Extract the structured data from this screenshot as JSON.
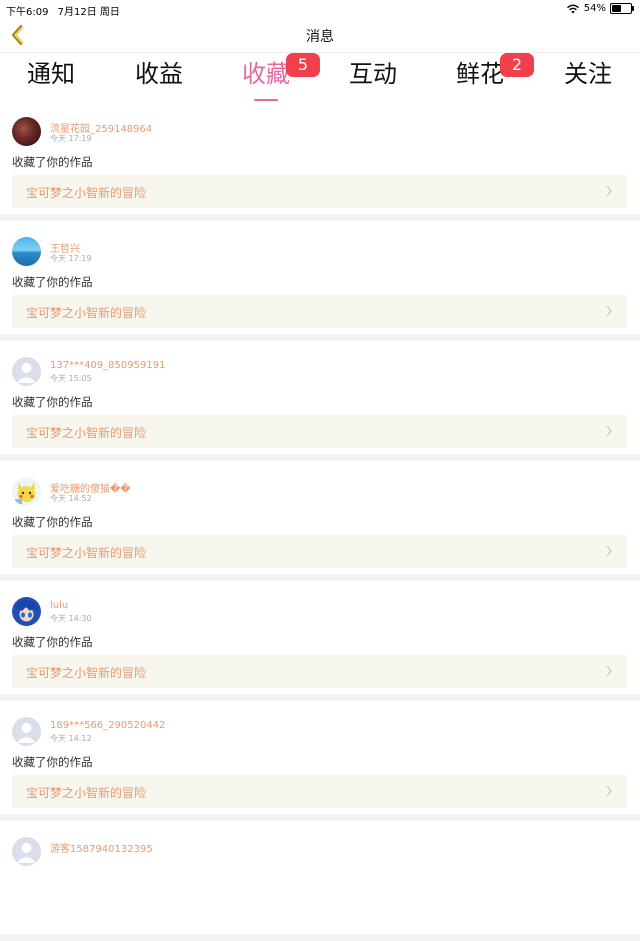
{
  "status_bar": {
    "time": "下午6:09",
    "date": "7月12日 周日",
    "battery": "54%",
    "battery_level": 0.54
  },
  "nav": {
    "title": "消息",
    "back_icon": "chevron-left-icon",
    "accent_color": "#e56aa0"
  },
  "tabs": [
    {
      "label": "通知",
      "badge": ""
    },
    {
      "label": "收益",
      "badge": ""
    },
    {
      "label": "收藏",
      "badge": "5",
      "active": true
    },
    {
      "label": "互动",
      "badge": ""
    },
    {
      "label": "鲜花",
      "badge": "2"
    },
    {
      "label": "关注",
      "badge": ""
    }
  ],
  "items": [
    {
      "user": "流星花园_259148964",
      "time": "今天 17:19",
      "action": "收藏了你的作品",
      "work": "宝可梦之小智新的冒险"
    },
    {
      "user": "王哲兴",
      "time": "今天 17:19",
      "action": "收藏了你的作品",
      "work": "宝可梦之小智新的冒险"
    },
    {
      "user": "137***409_850959191",
      "time": "今天 15:05",
      "action": "收藏了你的作品",
      "work": "宝可梦之小智新的冒险"
    },
    {
      "user": "爱吃糖的傻猫��",
      "time": "今天 14:52",
      "action": "收藏了你的作品",
      "work": "宝可梦之小智新的冒险"
    },
    {
      "user": "lulu",
      "time": "今天 14:30",
      "action": "收藏了你的作品",
      "work": "宝可梦之小智新的冒险"
    },
    {
      "user": "189***566_290520442",
      "time": "今天 14:12",
      "action": "收藏了你的作品",
      "work": "宝可梦之小智新的冒险"
    },
    {
      "user": "游客1587940132395",
      "time": "",
      "action": "",
      "work": ""
    }
  ]
}
